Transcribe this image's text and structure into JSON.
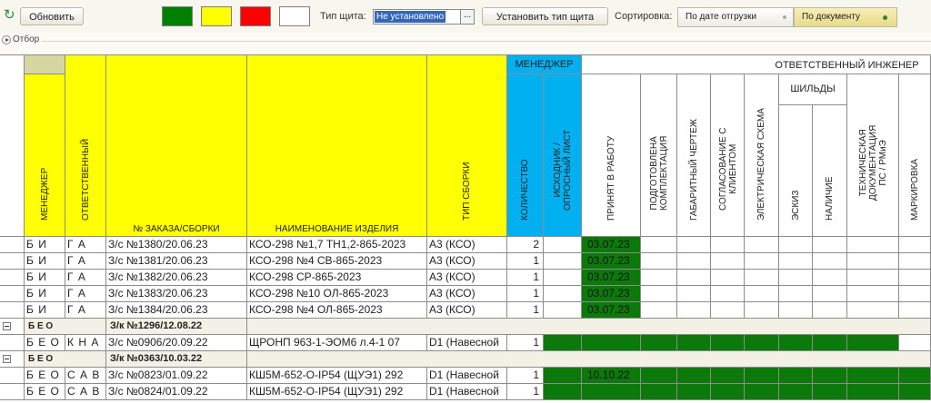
{
  "toolbar": {
    "refresh_label": "Обновить",
    "swatch_colors": [
      "#008000",
      "#ffff00",
      "#ff0000",
      "#ffffff"
    ],
    "shield_type_label": "Тип щита:",
    "shield_type_value": "Не установлено",
    "ellipsis": "...",
    "set_shield_type_label": "Установить тип щита",
    "sort_label": "Сортировка:",
    "sort_options": [
      "По дате отгрузки",
      "По документу"
    ],
    "sort_selected": "По документу"
  },
  "filter": {
    "label": "Отбор"
  },
  "table": {
    "group_headers": {
      "manager": "МЕНЕДЖЕР",
      "responsible_engineer": "ОТВЕТСТВЕННЫЙ ИНЖЕНЕР",
      "nameplates": "ШИЛЬДЫ"
    },
    "columns": {
      "manager": "МЕНЕДЖЕР",
      "responsible": "ОТВЕТСТВЕННЫЙ",
      "order": "№ ЗАКАЗА/СБОРКИ",
      "product": "НАИМЕНОВАНИЕ ИЗДЕЛИЯ",
      "assembly_type": "ТИП СБОРКИ",
      "quantity": "КОЛИЧЕСТВО",
      "source_sheet": [
        "ИСХОДНИК /",
        "ОПРОСНЫЙ ЛИСТ"
      ],
      "accepted": "ПРИНЯТ В РАБОТУ",
      "kit_prepared": [
        "ПОДГОТОВЛЕНА",
        "КОМПЛЕКТАЦИЯ"
      ],
      "dimension_drawing": "ГАБАРИТНЫЙ ЧЕРТЕЖ",
      "client_approval": [
        "СОГЛАСОВАНИЕ С",
        "КЛИЕНТОМ"
      ],
      "electrical_scheme": "ЭЛЕКТРИЧЕСКАЯ СХЕМА",
      "sketch": "ЭСКИЗ",
      "availability": "НАЛИЧИЕ",
      "tech_docs": [
        "ТЕХНИЧЕСКАЯ",
        "ДОКУМЕНТАЦИЯ",
        "ПС / РМиЭ"
      ],
      "marking": "МАРКИРОВКА"
    },
    "rows": [
      {
        "kind": "item",
        "manager": "Б И",
        "responsible": "Г А",
        "order": "З/с №1380/20.06.23",
        "product": "КСО-298 №1,7 ТН1,2-865-2023",
        "assembly_type": "А3 (КСО)",
        "quantity": "2",
        "accepted": "03.07.23",
        "green_from": "accepted",
        "green_to": "accepted"
      },
      {
        "kind": "item",
        "manager": "Б И",
        "responsible": "Г А",
        "order": "З/с №1381/20.06.23",
        "product": "КСО-298 №4 СВ-865-2023",
        "assembly_type": "А3 (КСО)",
        "quantity": "1",
        "accepted": "03.07.23",
        "green_from": "accepted",
        "green_to": "accepted"
      },
      {
        "kind": "item",
        "manager": "Б И",
        "responsible": "Г А",
        "order": "З/с №1382/20.06.23",
        "product": "КСО-298 СР-865-2023",
        "assembly_type": "А3 (КСО)",
        "quantity": "1",
        "accepted": "03.07.23",
        "green_from": "accepted",
        "green_to": "accepted"
      },
      {
        "kind": "item",
        "manager": "Б И",
        "responsible": "Г А",
        "order": "З/с №1383/20.06.23",
        "product": "КСО-298 №10 ОЛ-865-2023",
        "assembly_type": "А3 (КСО)",
        "quantity": "1",
        "accepted": "03.07.23",
        "green_from": "accepted",
        "green_to": "accepted"
      },
      {
        "kind": "item",
        "manager": "Б И",
        "responsible": "Г А",
        "order": "З/с №1384/20.06.23",
        "product": "КСО-298 №4 ОЛ-865-2023",
        "assembly_type": "А3 (КСО)",
        "quantity": "1",
        "accepted": "03.07.23",
        "green_from": "accepted",
        "green_to": "accepted"
      },
      {
        "kind": "group",
        "manager": "Б Е О",
        "order": "З/к №1296/12.08.22"
      },
      {
        "kind": "item",
        "manager": "Б Е О",
        "responsible": "К Н А",
        "order": "З/с №0906/20.09.22",
        "product": "ЩРОНП   963-1-ЭОМ6 л.4-1 07",
        "assembly_type": "D1 (Навесной",
        "quantity": "1",
        "accepted": "",
        "green_from": "source_sheet",
        "green_to": "tech_docs"
      },
      {
        "kind": "group",
        "manager": "Б Е О",
        "order": "З/к №0363/10.03.22"
      },
      {
        "kind": "item",
        "manager": "Б Е О",
        "responsible": "С А В",
        "order": "З/с №0823/01.09.22",
        "product": "КШ5М-652-О-IP54 (ЩУЭ1)  292",
        "assembly_type": "D1 (Навесной",
        "quantity": "1",
        "accepted": "10.10.22",
        "green_from": "source_sheet",
        "green_to": "marking"
      },
      {
        "kind": "item",
        "manager": "Б Е О",
        "responsible": "С А В",
        "order": "З/с №0824/01.09.22",
        "product": "КШ5М-652-О-IP54 (ЩУЭ1)  292",
        "assembly_type": "D1 (Навесной",
        "quantity": "1",
        "accepted": "",
        "green_from": "source_sheet",
        "green_to": "marking"
      }
    ]
  }
}
